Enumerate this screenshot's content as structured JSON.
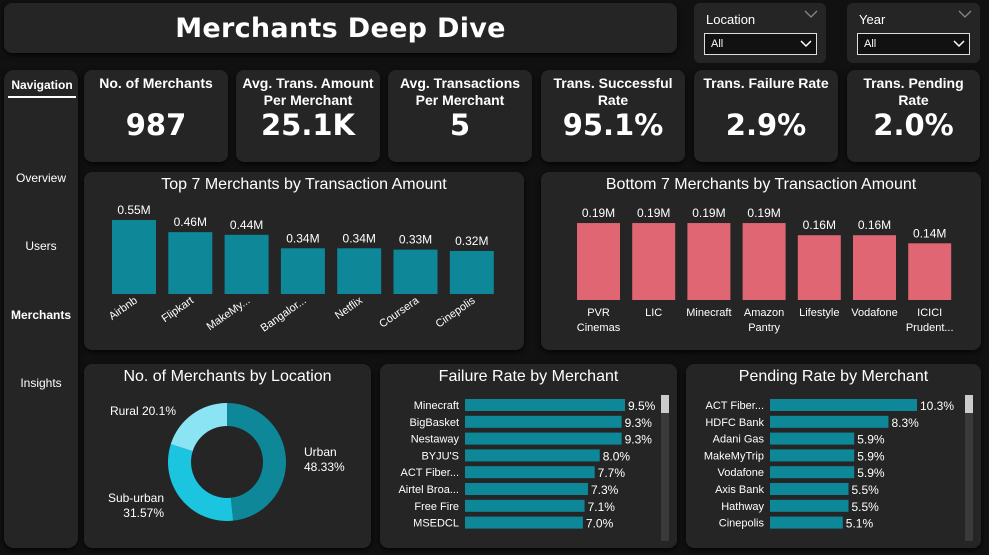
{
  "header": {
    "title": "Merchants Deep Dive"
  },
  "filters": [
    {
      "label": "Location",
      "value": "All"
    },
    {
      "label": "Year",
      "value": "All"
    }
  ],
  "navigation": {
    "title": "Navigation",
    "items": [
      "Overview",
      "Users",
      "Merchants",
      "Insights"
    ],
    "active": "Merchants"
  },
  "kpis": [
    {
      "label": "No. of Merchants",
      "value": "987"
    },
    {
      "label": "Avg. Trans. Amount Per Merchant",
      "value": "25.1K"
    },
    {
      "label": "Avg. Transactions Per Merchant",
      "value": "5"
    },
    {
      "label": "Trans. Successful Rate",
      "value": "95.1%"
    },
    {
      "label": "Trans. Failure Rate",
      "value": "2.9%"
    },
    {
      "label": "Trans. Pending Rate",
      "value": "2.0%"
    }
  ],
  "colors": {
    "teal": "#0e8799",
    "pink": "#e06673",
    "teal_light": "#1bc4df",
    "teal_pale": "#8ae4f4",
    "card": "#252525"
  },
  "chart_data": [
    {
      "type": "bar",
      "title": "Top 7 Merchants by Transaction Amount",
      "categories": [
        "Airbnb",
        "Flipkart",
        "MakeMy...",
        "Bangalor...",
        "Netflix",
        "Coursera",
        "Cinepolis"
      ],
      "values": [
        0.55,
        0.46,
        0.44,
        0.34,
        0.34,
        0.33,
        0.32
      ],
      "data_labels": [
        "0.55M",
        "0.46M",
        "0.44M",
        "0.34M",
        "0.34M",
        "0.33M",
        "0.32M"
      ],
      "ylim": [
        0,
        0.6
      ]
    },
    {
      "type": "bar",
      "title": "Bottom 7 Merchants by Transaction Amount",
      "categories": [
        "PVR Cinemas",
        "LIC",
        "Minecraft",
        "Amazon Pantry",
        "Lifestyle",
        "Vodafone",
        "ICICI Prudent..."
      ],
      "values": [
        0.19,
        0.19,
        0.19,
        0.19,
        0.16,
        0.16,
        0.14
      ],
      "data_labels": [
        "0.19M",
        "0.19M",
        "0.19M",
        "0.19M",
        "0.16M",
        "0.16M",
        "0.14M"
      ],
      "ylim": [
        0,
        0.2
      ]
    },
    {
      "type": "pie",
      "title": "No. of Merchants by Location",
      "categories": [
        "Urban",
        "Sub-urban",
        "Rural"
      ],
      "values": [
        48.33,
        31.57,
        20.1
      ],
      "data_labels": [
        "Urban 48.33%",
        "Sub-urban 31.57%",
        "Rural 20.1%"
      ]
    },
    {
      "type": "bar",
      "orientation": "horizontal",
      "title": "Failure Rate by Merchant",
      "categories": [
        "Minecraft",
        "BigBasket",
        "Nestaway",
        "BYJU'S",
        "ACT Fiber...",
        "Airtel Broa...",
        "Free Fire",
        "MSEDCL"
      ],
      "values": [
        9.5,
        9.3,
        9.3,
        8.0,
        7.7,
        7.3,
        7.1,
        7.0
      ],
      "data_labels": [
        "9.5%",
        "9.3%",
        "9.3%",
        "8.0%",
        "7.7%",
        "7.3%",
        "7.1%",
        "7.0%"
      ],
      "xlim": [
        0,
        9.5
      ]
    },
    {
      "type": "bar",
      "orientation": "horizontal",
      "title": "Pending Rate by Merchant",
      "categories": [
        "ACT Fiber...",
        "HDFC Bank",
        "Adani Gas",
        "MakeMyTrip",
        "Vodafone",
        "Axis Bank",
        "Hathway",
        "Cinepolis"
      ],
      "values": [
        10.3,
        8.3,
        5.9,
        5.9,
        5.9,
        5.5,
        5.5,
        5.1
      ],
      "data_labels": [
        "10.3%",
        "8.3%",
        "5.9%",
        "5.9%",
        "5.9%",
        "5.5%",
        "5.5%",
        "5.1%"
      ],
      "xlim": [
        0,
        10.3
      ]
    }
  ]
}
